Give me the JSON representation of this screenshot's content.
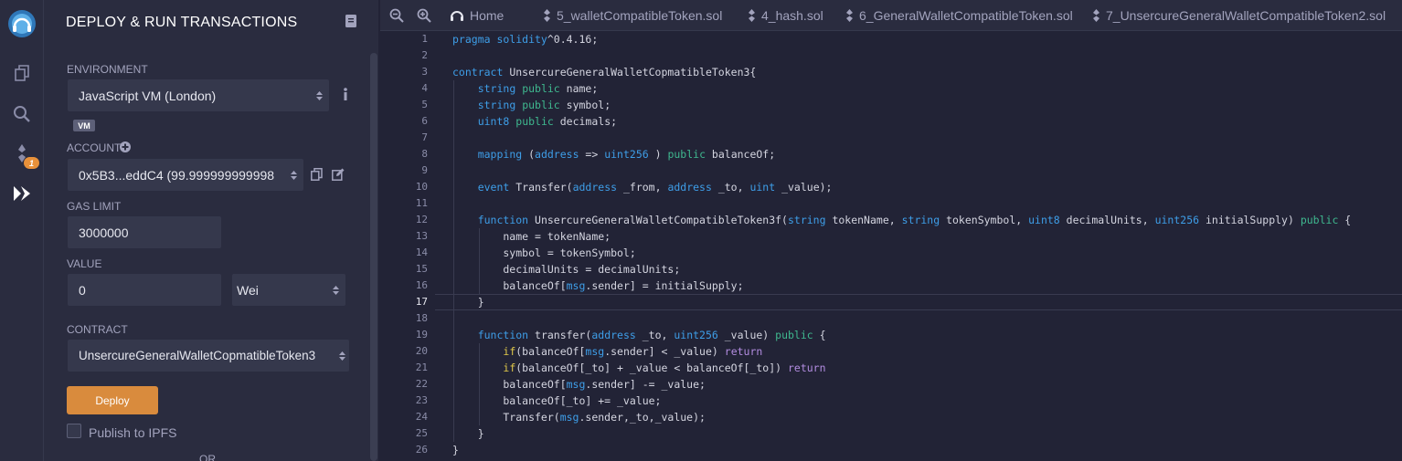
{
  "sidebar": {
    "icons": [
      "remix-logo-icon",
      "file-explorer-icon",
      "search-icon",
      "solidity-compiler-icon",
      "deploy-run-icon"
    ],
    "compiler_badge": "1"
  },
  "panel": {
    "title": "DEPLOY & RUN TRANSACTIONS",
    "environment_label": "ENVIRONMENT",
    "environment_value": "JavaScript VM (London)",
    "vm_tag": "VM",
    "account_label": "ACCOUNT",
    "account_value": "0x5B3...eddC4 (99.999999999998",
    "gas_limit_label": "GAS LIMIT",
    "gas_limit_value": "3000000",
    "value_label": "VALUE",
    "value_value": "0",
    "value_unit": "Wei",
    "contract_label": "CONTRACT",
    "contract_value": "UnsercureGeneralWalletCopmatibleToken3",
    "deploy_label": "Deploy",
    "publish_label": "Publish to IPFS",
    "or_label": "OR"
  },
  "tabs": [
    {
      "label": "Home",
      "icon": "remix-home-icon"
    },
    {
      "label": "5_walletCompatibleToken.sol",
      "icon": "solidity-file-icon"
    },
    {
      "label": "4_hash.sol",
      "icon": "solidity-file-icon"
    },
    {
      "label": "6_GeneralWalletCompatibleToken.sol",
      "icon": "solidity-file-icon"
    },
    {
      "label": "7_UnsercureGeneralWalletCompatibleToken2.sol",
      "icon": "solidity-file-icon"
    }
  ],
  "editor": {
    "current_line": 17,
    "line_numbers": [
      "1",
      "2",
      "3",
      "4",
      "5",
      "6",
      "7",
      "8",
      "9",
      "10",
      "11",
      "12",
      "13",
      "14",
      "15",
      "16",
      "17",
      "18",
      "19",
      "20",
      "21",
      "22",
      "23",
      "24",
      "25",
      "26"
    ],
    "lines": [
      [
        [
          "kw",
          "pragma solidity"
        ],
        [
          "",
          "^0.4.16;"
        ]
      ],
      [],
      [
        [
          "kw",
          "contract"
        ],
        [
          "",
          " UnsercureGeneralWalletCopmatibleToken3{"
        ]
      ],
      [
        [
          "",
          "    "
        ],
        [
          "kw",
          "string"
        ],
        [
          "",
          " "
        ],
        [
          "fn",
          "public"
        ],
        [
          "",
          " name;"
        ]
      ],
      [
        [
          "",
          "    "
        ],
        [
          "kw",
          "string"
        ],
        [
          "",
          " "
        ],
        [
          "fn",
          "public"
        ],
        [
          "",
          " symbol;"
        ]
      ],
      [
        [
          "",
          "    "
        ],
        [
          "kw",
          "uint8"
        ],
        [
          "",
          " "
        ],
        [
          "fn",
          "public"
        ],
        [
          "",
          " decimals;"
        ]
      ],
      [],
      [
        [
          "",
          "    "
        ],
        [
          "kw",
          "mapping"
        ],
        [
          "",
          " ("
        ],
        [
          "kw",
          "address"
        ],
        [
          "",
          " => "
        ],
        [
          "kw",
          "uint256"
        ],
        [
          "",
          " ) "
        ],
        [
          "fn",
          "public"
        ],
        [
          "",
          " balanceOf;"
        ]
      ],
      [],
      [
        [
          "",
          "    "
        ],
        [
          "kw",
          "event"
        ],
        [
          "",
          " Transfer("
        ],
        [
          "kw",
          "address"
        ],
        [
          "",
          " _from, "
        ],
        [
          "kw",
          "address"
        ],
        [
          "",
          " _to, "
        ],
        [
          "kw",
          "uint"
        ],
        [
          "",
          " _value);"
        ]
      ],
      [],
      [
        [
          "",
          "    "
        ],
        [
          "kw",
          "function"
        ],
        [
          "",
          " UnsercureGeneralWalletCompatibleToken3f("
        ],
        [
          "kw",
          "string"
        ],
        [
          "",
          " tokenName, "
        ],
        [
          "kw",
          "string"
        ],
        [
          "",
          " tokenSymbol, "
        ],
        [
          "kw",
          "uint8"
        ],
        [
          "",
          " decimalUnits, "
        ],
        [
          "kw",
          "uint256"
        ],
        [
          "",
          " initialSupply) "
        ],
        [
          "fn",
          "public"
        ],
        [
          "",
          " {"
        ]
      ],
      [
        [
          "",
          "        name = tokenName;"
        ]
      ],
      [
        [
          "",
          "        symbol = tokenSymbol;"
        ]
      ],
      [
        [
          "",
          "        decimalUnits = decimalUnits;"
        ]
      ],
      [
        [
          "",
          "        balanceOf["
        ],
        [
          "kw",
          "msg"
        ],
        [
          "",
          ".sender] = initialSupply;"
        ]
      ],
      [
        [
          "",
          "    }"
        ]
      ],
      [],
      [
        [
          "",
          "    "
        ],
        [
          "kw",
          "function"
        ],
        [
          "",
          " transfer("
        ],
        [
          "kw",
          "address"
        ],
        [
          "",
          " _to, "
        ],
        [
          "kw",
          "uint256"
        ],
        [
          "",
          " _value) "
        ],
        [
          "fn",
          "public"
        ],
        [
          "",
          " {"
        ]
      ],
      [
        [
          "",
          "        "
        ],
        [
          "yl",
          "if"
        ],
        [
          "",
          "(balanceOf["
        ],
        [
          "kw",
          "msg"
        ],
        [
          "",
          ".sender] < _value) "
        ],
        [
          "pu",
          "return"
        ],
        [
          ";"
        ]
      ],
      [
        [
          "",
          "        "
        ],
        [
          "yl",
          "if"
        ],
        [
          "",
          "(balanceOf[_to] + _value < balanceOf[_to]) "
        ],
        [
          "pu",
          "return"
        ],
        [
          ";"
        ]
      ],
      [
        [
          "",
          "        balanceOf["
        ],
        [
          "kw",
          "msg"
        ],
        [
          "",
          ".sender] -= _value;"
        ]
      ],
      [
        [
          "",
          "        balanceOf[_to] += _value;"
        ]
      ],
      [
        [
          "",
          "        Transfer("
        ],
        [
          "kw",
          "msg"
        ],
        [
          "",
          ".sender,_to,_value);"
        ]
      ],
      [
        [
          "",
          "    }"
        ]
      ],
      [
        [
          "",
          "}"
        ]
      ]
    ]
  }
}
